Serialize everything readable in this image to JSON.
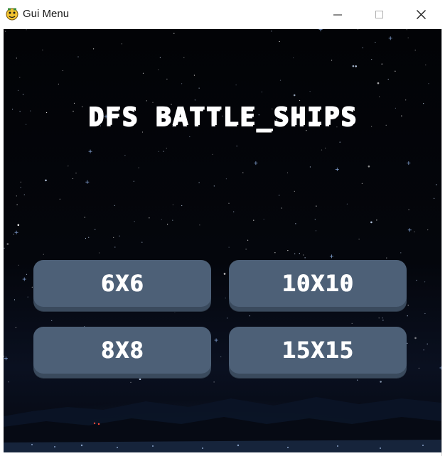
{
  "window": {
    "title": "Gui Menu",
    "controls": {
      "minimize": "minimize-icon",
      "maximize": "maximize-icon",
      "close": "close-icon"
    }
  },
  "game": {
    "title": "DFS BATTLE_SHIPS",
    "buttons": [
      {
        "label": "6X6"
      },
      {
        "label": "10X10"
      },
      {
        "label": "8X8"
      },
      {
        "label": "15X15"
      }
    ]
  },
  "colors": {
    "button_fill": "#4d6077",
    "button_shadow": "#3a4a5d",
    "sky": "#020306",
    "text": "#ffffff"
  }
}
